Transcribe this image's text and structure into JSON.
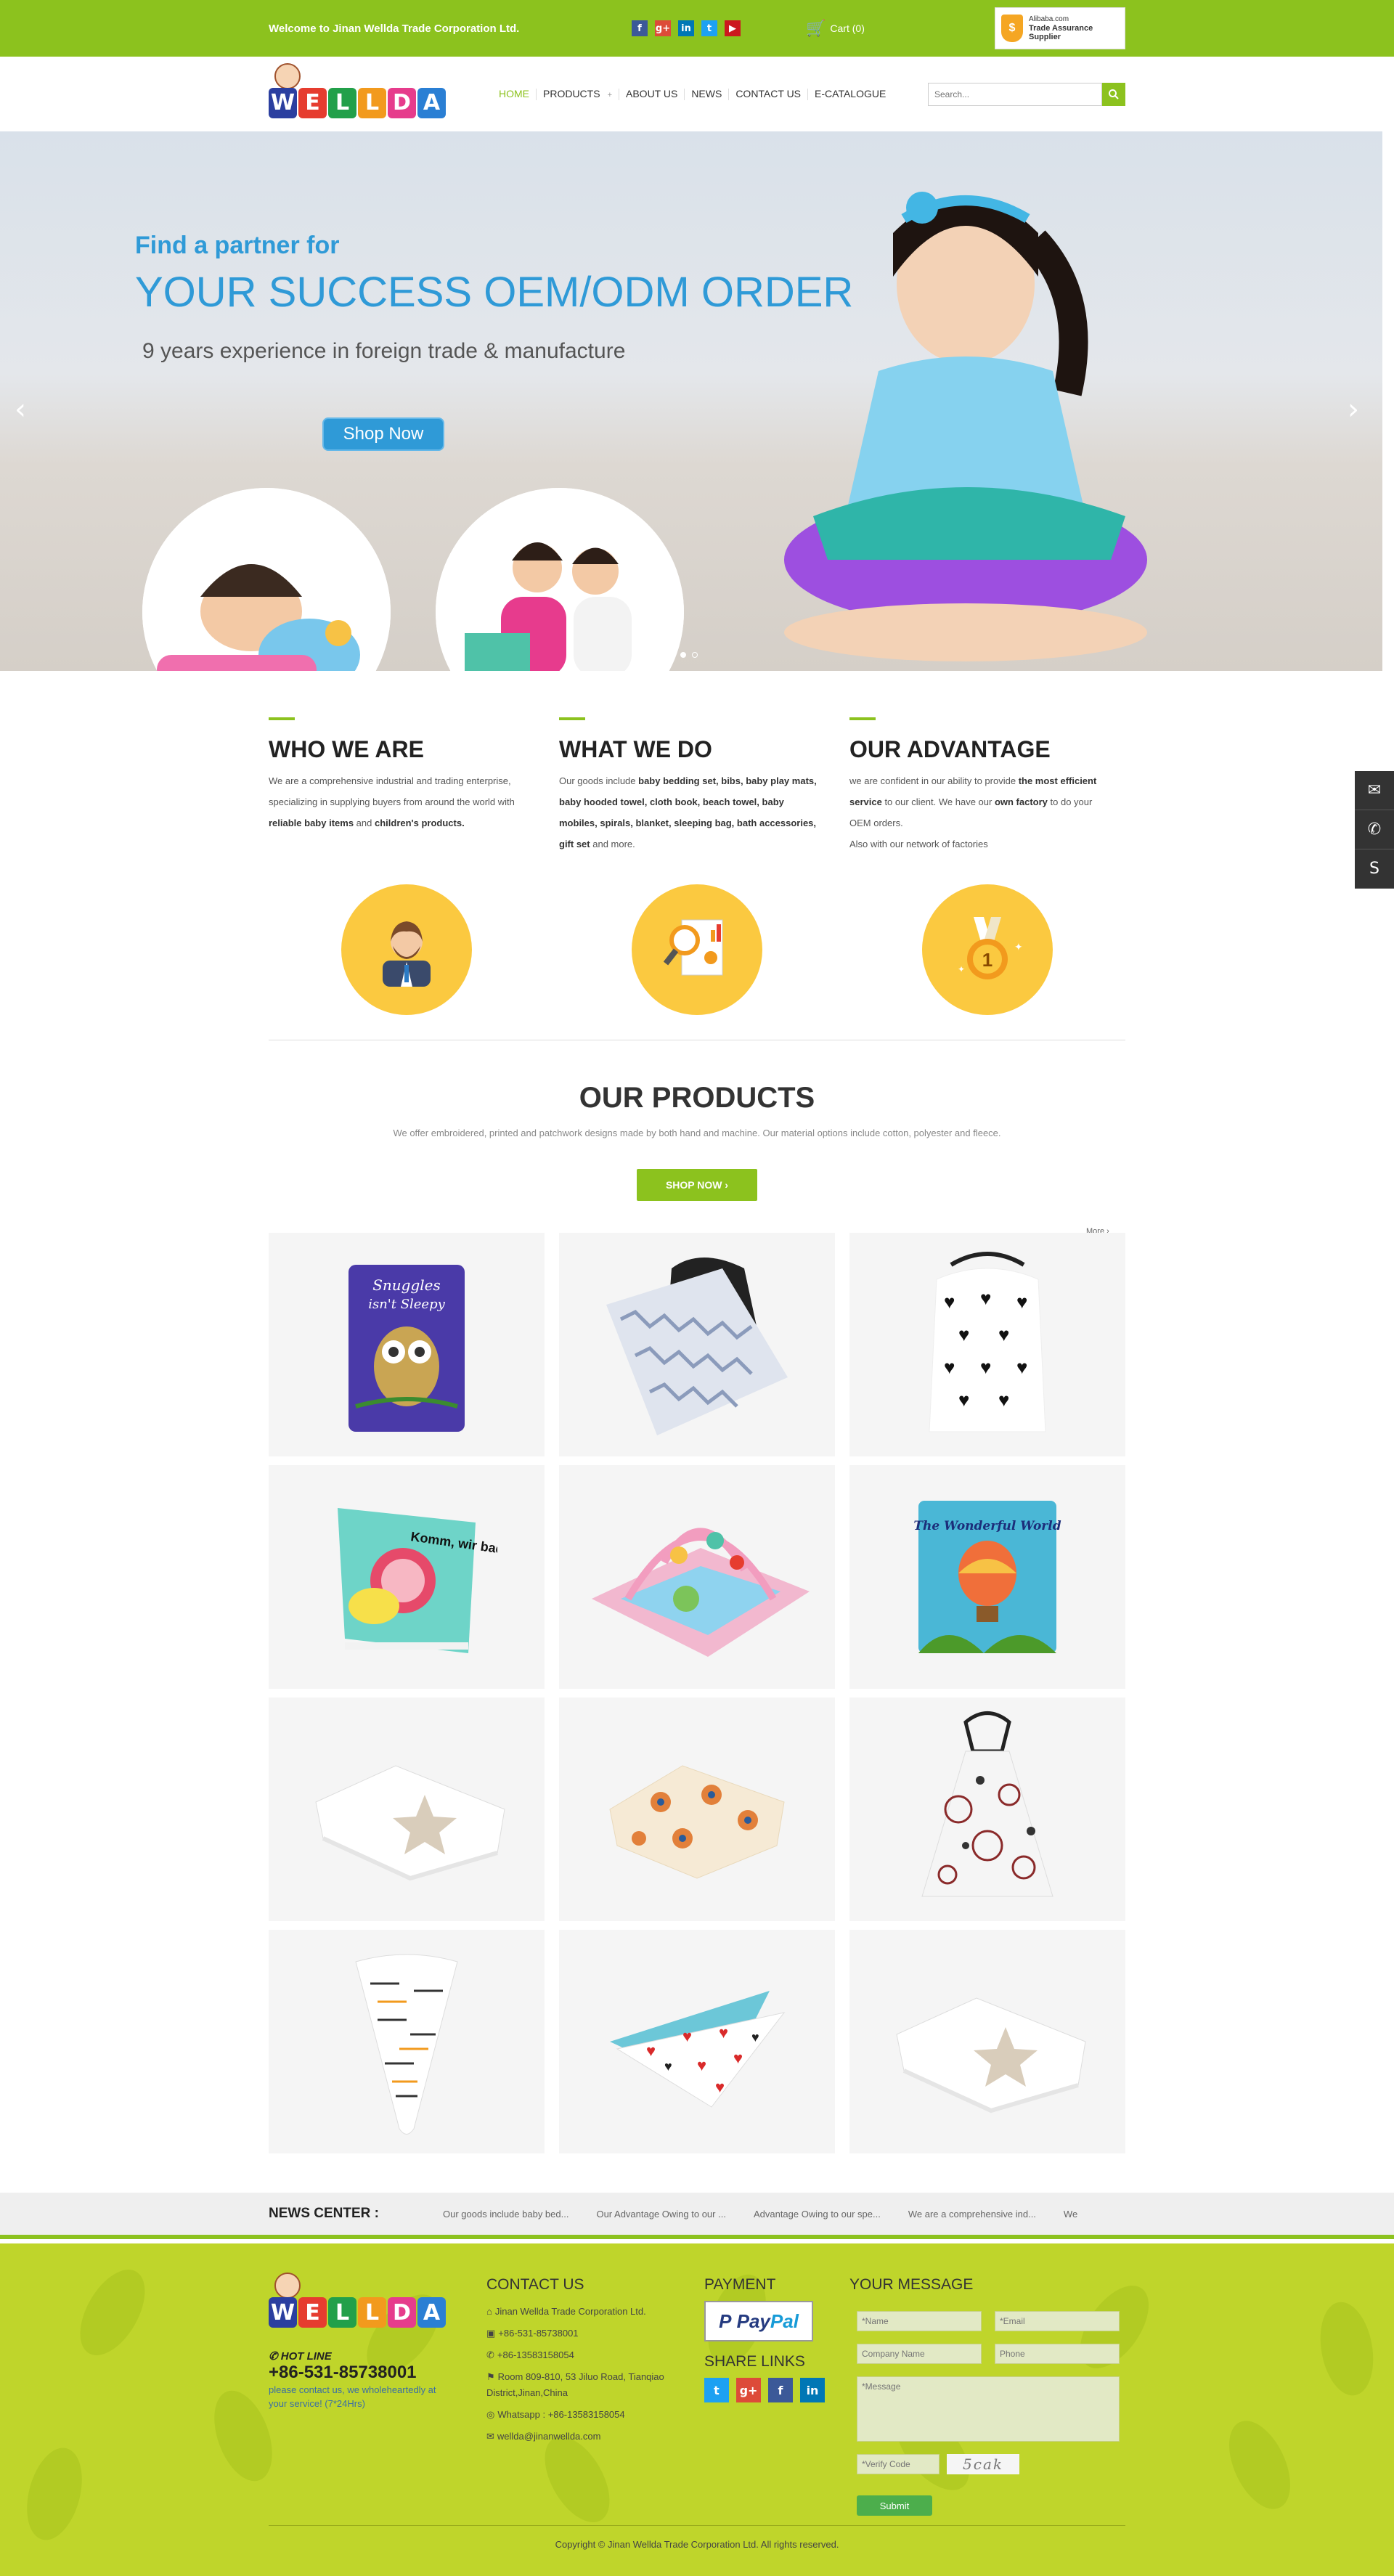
{
  "topbar": {
    "welcome": "Welcome to Jinan Wellda Trade Corporation Ltd.",
    "social": [
      {
        "icon": "facebook-icon",
        "glyph": "f",
        "color": "#3b5998"
      },
      {
        "icon": "google-plus-icon",
        "glyph": "g+",
        "color": "#dd4b39"
      },
      {
        "icon": "linkedin-icon",
        "glyph": "in",
        "color": "#0077b5"
      },
      {
        "icon": "twitter-icon",
        "glyph": "t",
        "color": "#1da1f2"
      },
      {
        "icon": "youtube-icon",
        "glyph": "▶",
        "color": "#cc181e"
      }
    ],
    "cart": "Cart (0)",
    "assurance": {
      "line1": "Alibaba.com",
      "line2": "Trade Assurance",
      "line3": "Supplier"
    }
  },
  "header": {
    "logo_letters": [
      "W",
      "E",
      "L",
      "L",
      "D",
      "A"
    ],
    "logo_colors": [
      "#2b3fa0",
      "#e63c2f",
      "#22a04a",
      "#f29a1d",
      "#e63c8c",
      "#2a7fd4"
    ],
    "nav": [
      "HOME",
      "PRODUCTS",
      "ABOUT US",
      "NEWS",
      "CONTACT US",
      "E-CATALOGUE"
    ],
    "search_placeholder": "Search..."
  },
  "banner": {
    "subtitle": "Find a partner for",
    "title": "YOUR SUCCESS OEM/ODM ORDER",
    "experience": "9  years experience in foreign trade & manufacture",
    "button": "Shop Now"
  },
  "features": [
    {
      "title": "WHO WE ARE",
      "html": "We are a comprehensive industrial and trading enterprise, specializing in supplying buyers from around the world with <b>reliable baby items</b> and <b>children's products.</b>"
    },
    {
      "title": "WHAT WE DO",
      "html": "Our goods include <b>baby bedding set, bibs, baby play mats, baby hooded towel, cloth book, beach towel, baby mobiles, spirals, blanket, sleeping bag, bath accessories, gift set</b> and more."
    },
    {
      "title": "OUR ADVANTAGE",
      "html": "we are confident in our ability to provide <b>the most efficient service</b> to our client. We have our <b>own factory</b> to do your OEM orders.<br>Also with our network of factories"
    }
  ],
  "products": {
    "title": "OUR PRODUCTS",
    "description": "We offer embroidered, printed and patchwork designs made by both hand and machine. Our material options include cotton, polyester and fleece.",
    "button": "SHOP NOW ›",
    "more": "More ›",
    "items": [
      "owl-cloth-book",
      "car-seat-canopy-chevron",
      "nursing-cover-hearts",
      "bath-cloth-book",
      "baby-play-mat",
      "wonderful-world-cloth-book",
      "muslin-blanket-star",
      "muslin-blanket-sun",
      "nursing-cover-floral",
      "bandana-bib-arrows",
      "bandana-bib-hearts",
      "muslin-blanket-star-2"
    ]
  },
  "news": {
    "label": "NEWS CENTER :",
    "items": [
      "Our goods include baby bed...",
      "Our Advantage Owing to our ...",
      "Advantage Owing to our spe...",
      "We are a comprehensive ind...",
      "We"
    ]
  },
  "footer": {
    "hotline_label": "HOT LINE",
    "hotline_number": "+86-531-85738001",
    "hotline_text": "please contact us, we wholeheartedly at your service!  (7*24Hrs)",
    "contact_title": "CONTACT US",
    "contact": [
      {
        "icon": "home-icon",
        "glyph": "⌂",
        "text": "Jinan Wellda Trade Corporation Ltd."
      },
      {
        "icon": "fax-icon",
        "glyph": "▣",
        "text": "+86-531-85738001"
      },
      {
        "icon": "phone-icon",
        "glyph": "✆",
        "text": "+86-13583158054"
      },
      {
        "icon": "address-icon",
        "glyph": "⚑",
        "text": "Room 809-810, 53 Jiluo Road, Tianqiao District,Jinan,China"
      },
      {
        "icon": "whatsapp-icon",
        "glyph": "◎",
        "text": "Whatsapp : +86-13583158054"
      },
      {
        "icon": "email-icon",
        "glyph": "✉",
        "text": "wellda@jinanwellda.com"
      }
    ],
    "payment_title": "PAYMENT",
    "paypal": "PayPal",
    "share_title": "SHARE LINKS",
    "share": [
      {
        "icon": "twitter-icon",
        "glyph": "t",
        "color": "#1da1f2"
      },
      {
        "icon": "google-plus-icon",
        "glyph": "g+",
        "color": "#dd4b39"
      },
      {
        "icon": "facebook-icon",
        "glyph": "f",
        "color": "#3b5998"
      },
      {
        "icon": "linkedin-icon",
        "glyph": "in",
        "color": "#0077b5"
      }
    ],
    "message_title": "YOUR MESSAGE",
    "fields": {
      "name": "*Name",
      "email": "*Email",
      "company": "Company Name",
      "phone": "Phone",
      "message": "*Message",
      "verify": "*Verify Code"
    },
    "captcha": "5cak",
    "submit": "Submit",
    "copyright": "Copyright © Jinan Wellda Trade Corporation Ltd.  All rights reserved."
  }
}
